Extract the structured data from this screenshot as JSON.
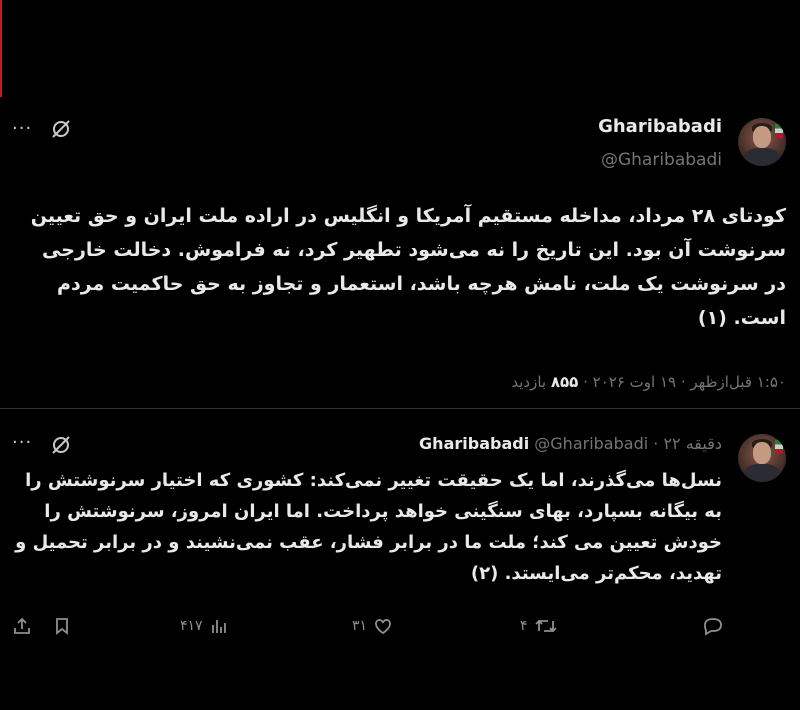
{
  "tweet": {
    "name": "Gharibabadi",
    "handle": "@Gharibabadi",
    "text": "کودتای ۲۸ مرداد، مداخله مستقیم آمریکا و انگلیس در اراده ملت ایران و حق تعیین سرنوشت آن بود. این تاریخ را نه می‌شود تطهیر کرد، نه فراموش. دخالت خارجی در سرنوشت یک ملت، نامش هرچه باشد، استعمار و تجاوز به حق حاکمیت مردم است. (۱)",
    "meta_prefix": "۱:۵۰ قبل‌ازظهر · ۱۹ اوت ۲۰۲۶ · ",
    "views_count": "۸۵۵",
    "views_label": " بازدید"
  },
  "reply": {
    "name": "Gharibabadi",
    "handle": "@Gharibabadi",
    "time": "· ۲۲ دقیقه",
    "text": "نسل‌ها می‌گذرند، اما یک حقیقت تغییر نمی‌کند: کشوری که اختیار سرنوشتش را به بیگانه بسپارد، بهای سنگینی خواهد پرداخت. اما ایران امروز، سرنوشتش را خودش تعیین می کند؛ ملت ما در برابر فشار، عقب نمی‌نشیند و در برابر تحمیل و تهدید، محکم‌تر می‌ایستد. (۲)"
  },
  "actions": {
    "reply_count": "",
    "retweet_count": "۴",
    "like_count": "۳۱",
    "views_count": "۴۱۷"
  },
  "icons": {
    "more": "more-icon",
    "grok": "grok-icon",
    "reply": "reply-icon",
    "retweet": "retweet-icon",
    "like": "heart-icon",
    "views": "views-icon",
    "bookmark": "bookmark-icon",
    "share": "share-icon"
  }
}
